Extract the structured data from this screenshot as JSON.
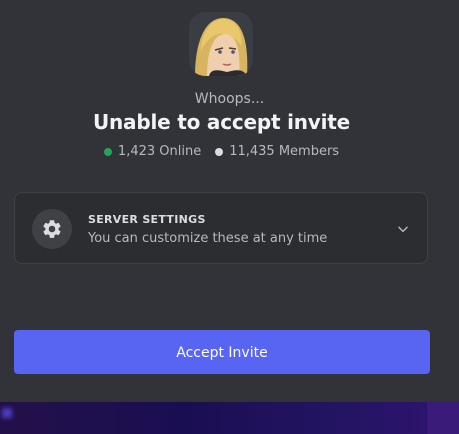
{
  "modal": {
    "subtitle": "Whoops...",
    "title": "Unable to accept invite",
    "online_count": "1,423 Online",
    "member_count": "11,435 Members",
    "colors": {
      "online_dot": "#23a559",
      "member_dot": "#dbdee1",
      "accent": "#5865f2"
    }
  },
  "settings": {
    "icon": "gear-icon",
    "heading": "SERVER SETTINGS",
    "description": "You can customize these at any time",
    "expand_icon": "chevron-down-icon"
  },
  "actions": {
    "accept_label": "Accept Invite"
  }
}
